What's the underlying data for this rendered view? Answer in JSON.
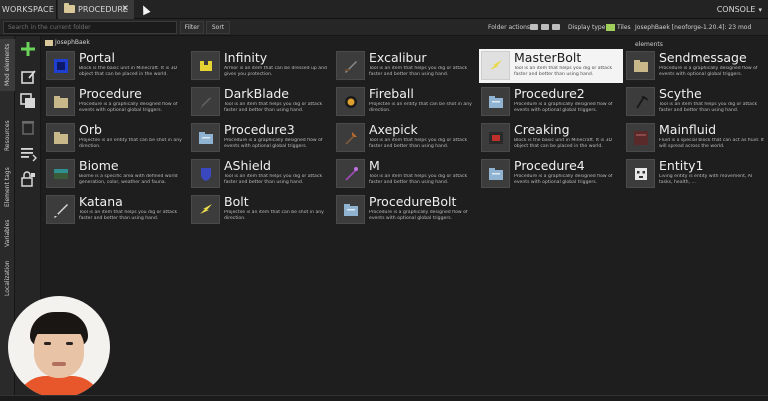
{
  "tabs": {
    "workspace": "WORKSPACE",
    "procedure": "PROCEDURE",
    "close": "✕",
    "console": "CONSOLE"
  },
  "toolbar": {
    "search_placeholder": "Search in the current folder",
    "filter": "Filter",
    "sort": "Sort",
    "folder_actions": "Folder actions:",
    "display_type": "Display type:",
    "display_value": "Tiles",
    "workspace_info": "JosephBaek [neoforge-1.20.4]: 23 mod elements"
  },
  "sidebar": {
    "mod_elements": "Mod elements",
    "resources": "Resources",
    "element_tags": "Element tags",
    "variables": "Variables",
    "localization": "Localization"
  },
  "breadcrumb": "JosephBaek",
  "elements": [
    {
      "name": "Portal",
      "desc": "Block is the basic unit in Minecraft. It is 3D object that can be placed in the world.",
      "icon": "portal-block-icon",
      "color": "#1f3fd1"
    },
    {
      "name": "Infinity",
      "desc": "Armor is an item that can be dressed up and gives you protection.",
      "icon": "armor-icon",
      "color": "#e6d232"
    },
    {
      "name": "Excalibur",
      "desc": "Tool is an item that helps you dig or attack faster and better than using hand.",
      "icon": "sword-icon",
      "color": "#8c8c8c"
    },
    {
      "name": "MasterBolt",
      "desc": "Tool is an item that helps you dig or attack faster and better than using hand.",
      "icon": "bolt-icon",
      "color": "#e8d84a"
    },
    {
      "name": "Sendmessage",
      "desc": "Procedure is a graphically designed flow of events with optional global triggers.",
      "icon": "folder-icon",
      "color": "#c9b88a"
    },
    {
      "name": "Procedure",
      "desc": "Procedure is a graphically designed flow of events with optional global triggers.",
      "icon": "folder-icon",
      "color": "#c9b88a"
    },
    {
      "name": "DarkBlade",
      "desc": "Tool is an item that helps you dig or attack faster and better than using hand.",
      "icon": "dark-sword-icon",
      "color": "#4a4a4a"
    },
    {
      "name": "Fireball",
      "desc": "Projectile is an entity that can be shot in any direction.",
      "icon": "fireball-icon",
      "color": "#e0a030"
    },
    {
      "name": "Procedure2",
      "desc": "Procedure is a graphically designed flow of events with optional global triggers.",
      "icon": "procedure-folder-icon",
      "color": "#8fb3d1"
    },
    {
      "name": "Scythe",
      "desc": "Tool is an item that helps you dig or attack faster and better than using hand.",
      "icon": "scythe-icon",
      "color": "#2a2a2a"
    },
    {
      "name": "Orb",
      "desc": "Projectile is an entity that can be shot in any direction.",
      "icon": "folder-icon",
      "color": "#c9b88a"
    },
    {
      "name": "Procedure3",
      "desc": "Procedure is a graphically designed flow of events with optional global triggers.",
      "icon": "procedure-folder-icon",
      "color": "#8fb3d1"
    },
    {
      "name": "Axepick",
      "desc": "Tool is an item that helps you dig or attack faster and better than using hand.",
      "icon": "axepick-icon",
      "color": "#c06a2a"
    },
    {
      "name": "Creaking",
      "desc": "Block is the basic unit in Minecraft. It is 3D object that can be placed in the world.",
      "icon": "creaking-block-icon",
      "color": "#c0302a"
    },
    {
      "name": "Mainfluid",
      "desc": "Fluid is a special block that can act as fluid. It will spread across the world.",
      "icon": "fluid-icon",
      "color": "#5a2a2a"
    },
    {
      "name": "Biome",
      "desc": "Biome is a specific area with defined world generation, color, weather and fauna.",
      "icon": "biome-icon",
      "color": "#2f8f8f"
    },
    {
      "name": "AShield",
      "desc": "Tool is an item that helps you dig or attack faster and better than using hand.",
      "icon": "shield-icon",
      "color": "#3a48c0"
    },
    {
      "name": "M",
      "desc": "Tool is an item that helps you dig or attack faster and better than using hand.",
      "icon": "staff-icon",
      "color": "#9a4ab0"
    },
    {
      "name": "Procedure4",
      "desc": "Procedure is a graphically designed flow of events with optional global triggers.",
      "icon": "procedure-folder-icon",
      "color": "#8fb3d1"
    },
    {
      "name": "Entity1",
      "desc": "Living entity is entity with movement, AI tasks, health, ...",
      "icon": "entity-icon",
      "color": "#e8e8e8"
    },
    {
      "name": "Katana",
      "desc": "Tool is an item that helps you dig or attack faster and better than using hand.",
      "icon": "katana-icon",
      "color": "#d8d8d8"
    },
    {
      "name": "Bolt",
      "desc": "Projectile is an item that can be shot in any direction.",
      "icon": "bolt-icon",
      "color": "#e8d84a"
    },
    {
      "name": "ProcedureBolt",
      "desc": "Procedure is a graphically designed flow of events with optional global triggers.",
      "icon": "procedure-folder-icon",
      "color": "#8fb3d1"
    }
  ],
  "selected": "MasterBolt"
}
